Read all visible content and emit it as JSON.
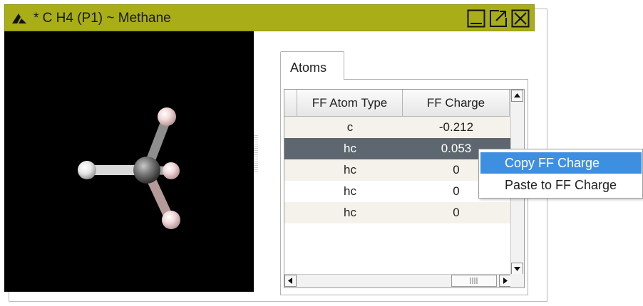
{
  "window": {
    "title": "* C H4  (P1) ~  Methane",
    "titlebar_color": "#a8ad18",
    "icons": [
      "app-logo-icon",
      "minimize-icon",
      "popout-icon",
      "close-icon"
    ]
  },
  "tabs": [
    {
      "label": "Atoms",
      "active": true
    }
  ],
  "grid": {
    "columns": [
      "FF Atom Type",
      "FF Charge"
    ],
    "rows": [
      {
        "type": "c",
        "charge": "-0.212"
      },
      {
        "type": "hc",
        "charge": "0.053"
      },
      {
        "type": "hc",
        "charge": "0"
      },
      {
        "type": "hc",
        "charge": "0"
      },
      {
        "type": "hc",
        "charge": "0"
      }
    ],
    "selected_row": 1,
    "selected_color": "#5e6770"
  },
  "context_menu": {
    "items": [
      {
        "label": "Copy FF Charge",
        "highlighted": true
      },
      {
        "label": "Paste to FF Charge",
        "highlighted": false
      }
    ],
    "highlight_color": "#3f8fe0"
  }
}
